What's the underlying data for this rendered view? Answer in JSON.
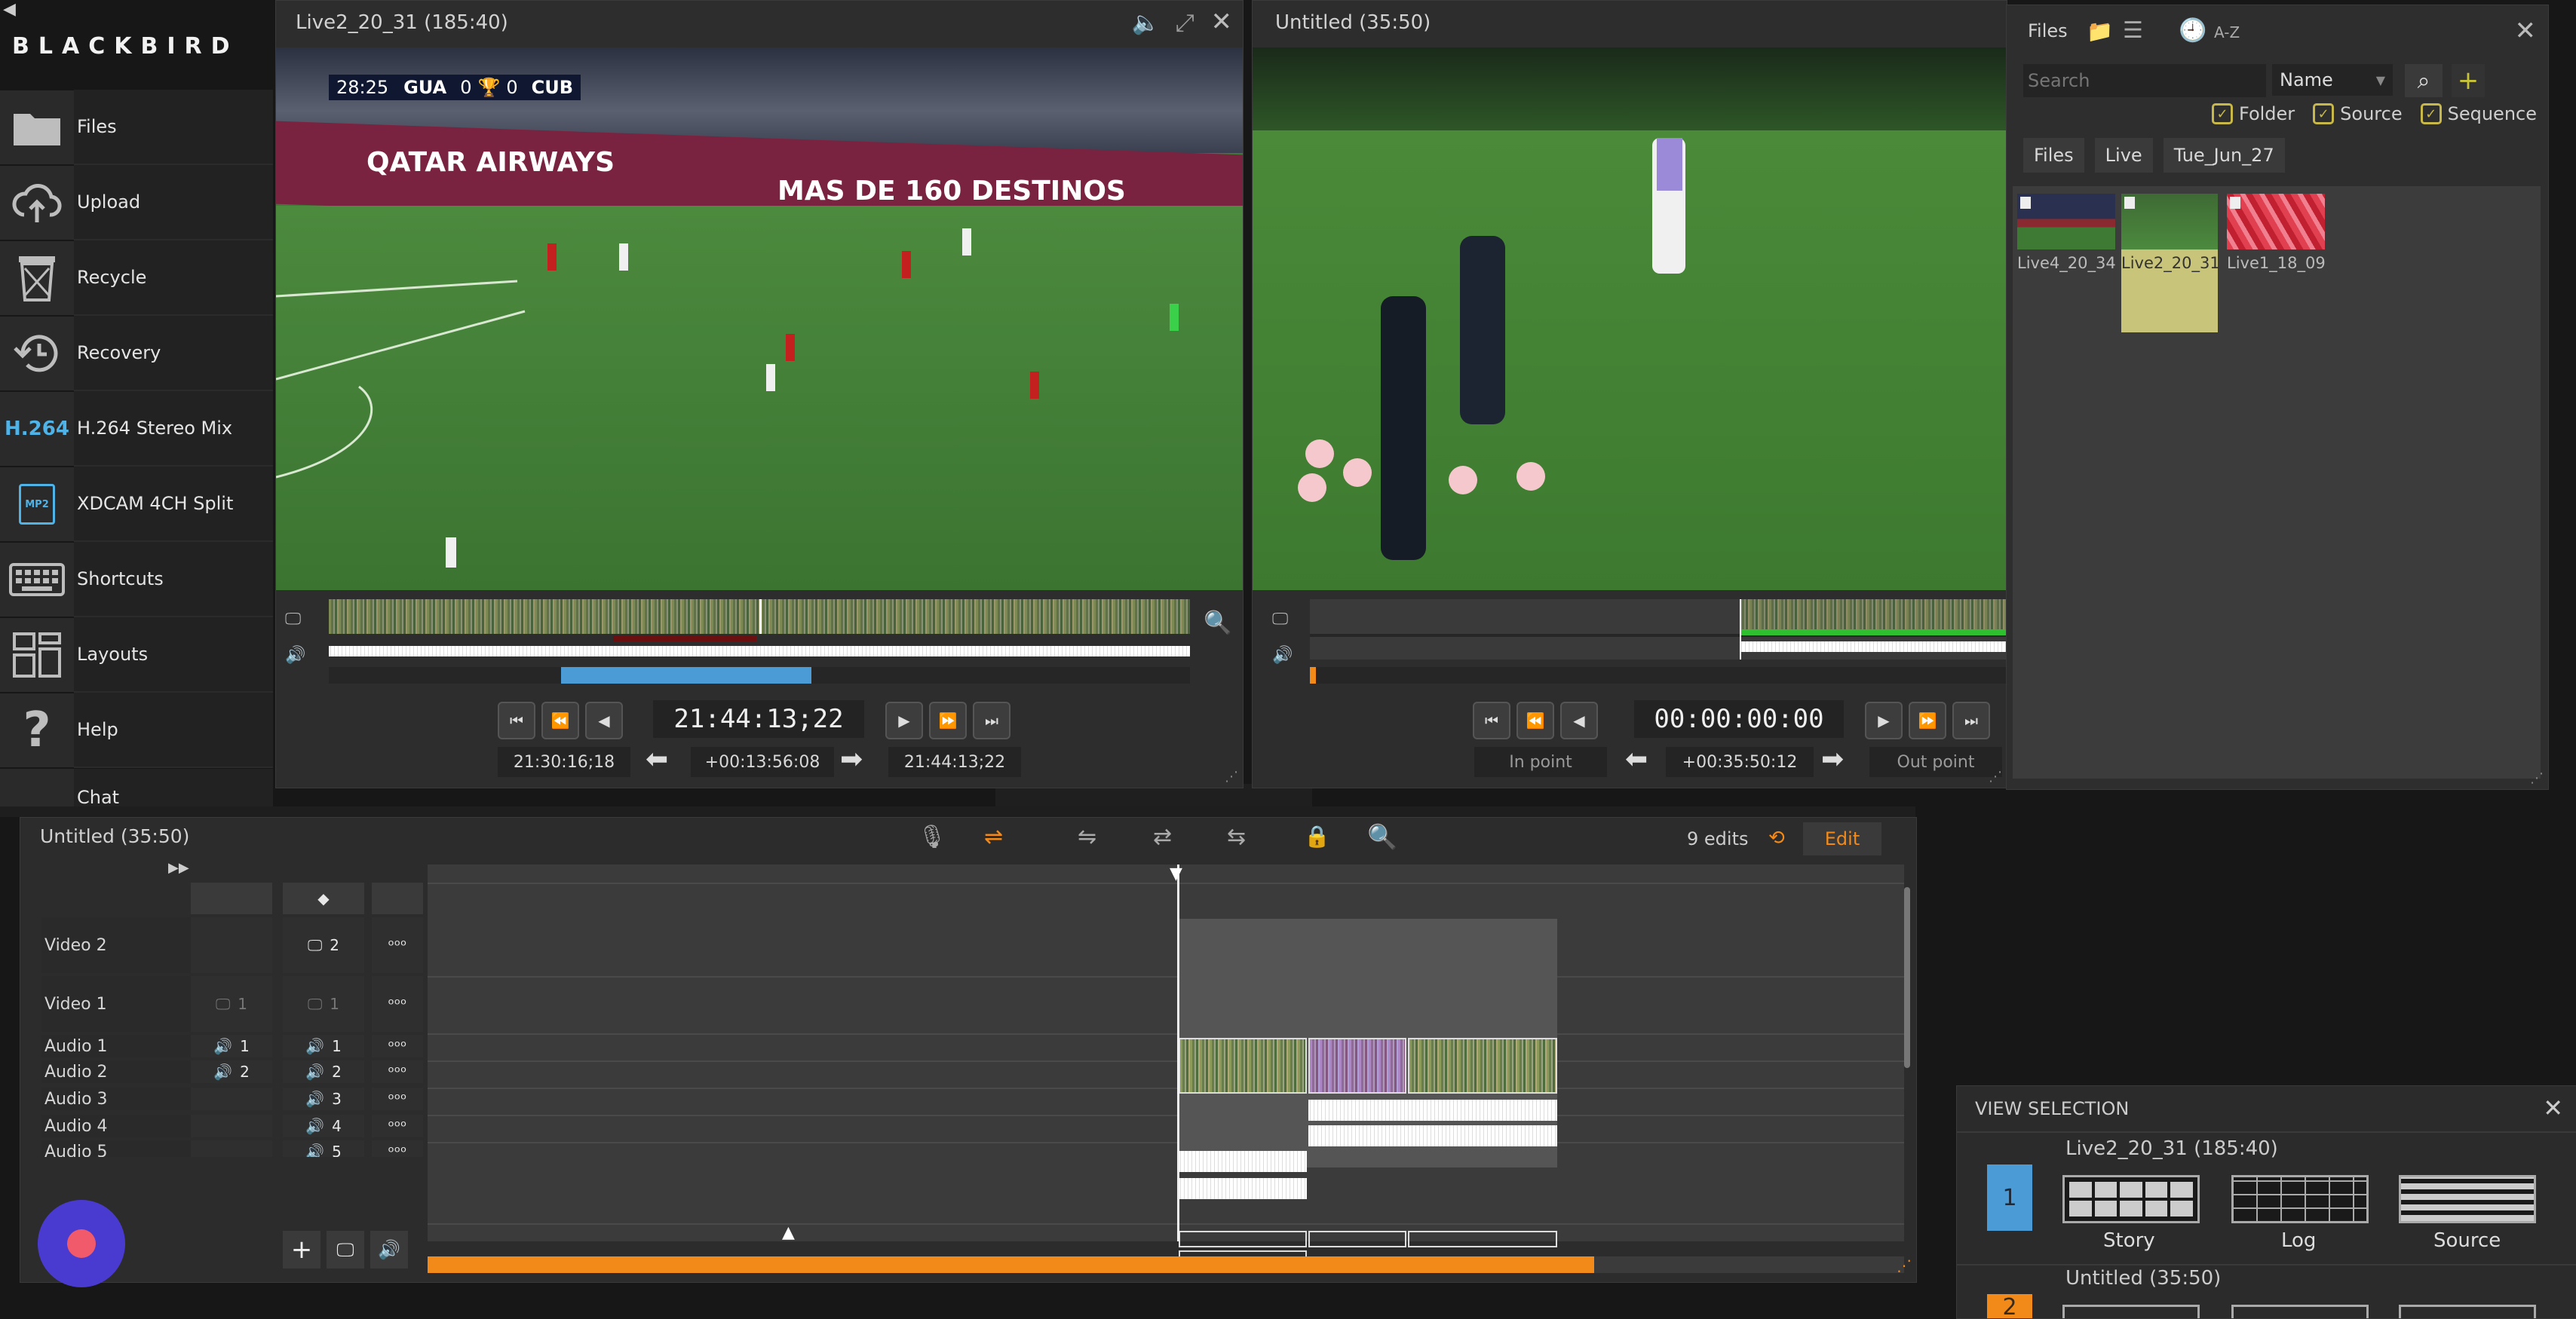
{
  "sidebar": {
    "logo": "BLACKBIRD",
    "items": [
      {
        "label": "Files",
        "icon": "folder-icon"
      },
      {
        "label": "Upload",
        "icon": "cloud-upload-icon"
      },
      {
        "label": "Recycle",
        "icon": "recycle-bin-icon"
      },
      {
        "label": "Recovery",
        "icon": "recovery-clock-icon"
      },
      {
        "label": "H.264 Stereo Mix",
        "icon": "h264-icon",
        "icon_text": "H.264"
      },
      {
        "label": "XDCAM 4CH Split",
        "icon": "mp2-file-icon",
        "icon_text": "MP2"
      },
      {
        "label": "Shortcuts",
        "icon": "keyboard-icon"
      },
      {
        "label": "Layouts",
        "icon": "layouts-icon"
      },
      {
        "label": "Help",
        "icon": "help-icon"
      },
      {
        "label": "Chat",
        "icon": "chat-icon"
      }
    ]
  },
  "source_viewer": {
    "title": "Live2_20_31 (185:40)",
    "scoreboard": {
      "time": "28:25",
      "home": "GUA",
      "home_score": "0",
      "away_score": "0",
      "away": "CUB"
    },
    "ad_left": "QATAR AIRWAYS",
    "ad_right": "MAS DE 160 DESTINOS",
    "timecode": "21:44:13;22",
    "in_tc": "21:30:16;18",
    "duration_tc": "+00:13:56:08",
    "out_tc": "21:44:13;22",
    "playhead_fraction": 0.5,
    "marked_range": [
      0.27,
      0.56
    ]
  },
  "record_viewer": {
    "title": "Untitled (35:50)",
    "timecode": "00:00:00:00",
    "in_label": "In point",
    "duration_tc": "+00:35:50:12",
    "out_label": "Out point"
  },
  "files_panel": {
    "title": "Files",
    "sort_label": "A-Z",
    "search_placeholder": "Search",
    "sort_select": "Name",
    "filters": [
      {
        "label": "Folder",
        "checked": true
      },
      {
        "label": "Source",
        "checked": true
      },
      {
        "label": "Sequence",
        "checked": true
      }
    ],
    "breadcrumbs": [
      "Files",
      "Live",
      "Tue_Jun_27"
    ],
    "thumbnails": [
      {
        "label": "Live4_20_34",
        "selected": false
      },
      {
        "label": "Live2_20_31",
        "selected": true
      },
      {
        "label": "Live1_18_09",
        "selected": false
      }
    ]
  },
  "timeline": {
    "title": "Untitled (35:50)",
    "edits": "9 edits",
    "mode_label": "Edit",
    "tracks": [
      {
        "name": "Video 2",
        "src": "",
        "rec": "2"
      },
      {
        "name": "Video 1",
        "src": "1",
        "rec": "1"
      },
      {
        "name": "Audio 1",
        "src": "1",
        "rec": "1"
      },
      {
        "name": "Audio 2",
        "src": "2",
        "rec": "2"
      },
      {
        "name": "Audio 3",
        "src": "",
        "rec": "3"
      },
      {
        "name": "Audio 4",
        "src": "",
        "rec": "4"
      },
      {
        "name": "Audio 5",
        "src": "",
        "rec": "5"
      }
    ],
    "progress_fraction": 0.79
  },
  "view_selection": {
    "title": "VIEW SELECTION",
    "entries": [
      {
        "number": "1",
        "name": "Live2_20_31 (185:40)",
        "options": [
          "Story",
          "Log",
          "Source"
        ]
      },
      {
        "number": "2",
        "name": "Untitled (35:50)"
      }
    ]
  },
  "colors": {
    "accent_orange": "#f28a1a",
    "accent_blue": "#4a9bd6",
    "selected_yellow": "#c8c47a",
    "check_yellow": "#c8b84a"
  }
}
